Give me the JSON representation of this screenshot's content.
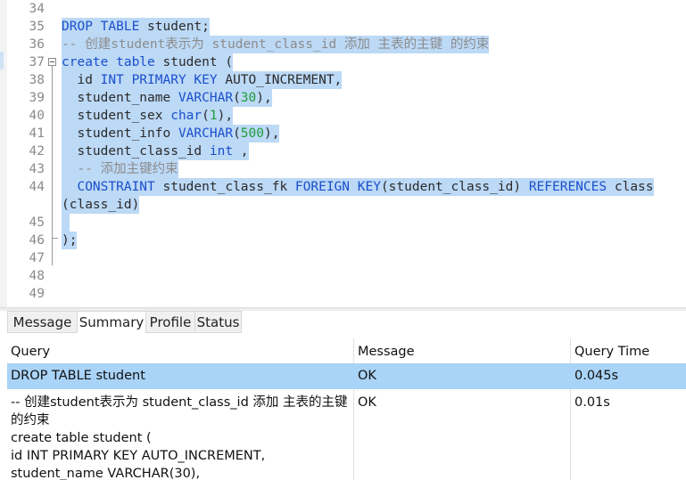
{
  "editor": {
    "lines": [
      {
        "num": "34",
        "tokens": []
      },
      {
        "num": "35",
        "tokens": [
          {
            "t": "DROP TABLE",
            "c": "kw"
          },
          {
            "t": " student;",
            "c": ""
          }
        ],
        "sel": true
      },
      {
        "num": "36",
        "tokens": [
          {
            "t": "-- 创建student表示为 student_class_id 添加 主表的主键 的约束",
            "c": "cm"
          }
        ],
        "sel": true
      },
      {
        "num": "37",
        "tokens": [
          {
            "t": "create table",
            "c": "kw"
          },
          {
            "t": " student (",
            "c": ""
          }
        ],
        "sel": true,
        "fold": true
      },
      {
        "num": "38",
        "tokens": [
          {
            "t": "  id ",
            "c": ""
          },
          {
            "t": "INT PRIMARY KEY",
            "c": "kw"
          },
          {
            "t": " AUTO_INCREMENT,",
            "c": ""
          }
        ],
        "sel": true
      },
      {
        "num": "39",
        "tokens": [
          {
            "t": "  student_name ",
            "c": ""
          },
          {
            "t": "VARCHAR",
            "c": "kw"
          },
          {
            "t": "(",
            "c": ""
          },
          {
            "t": "30",
            "c": "num"
          },
          {
            "t": "),",
            "c": ""
          }
        ],
        "sel": true
      },
      {
        "num": "40",
        "tokens": [
          {
            "t": "  student_sex ",
            "c": ""
          },
          {
            "t": "char",
            "c": "kw"
          },
          {
            "t": "(",
            "c": ""
          },
          {
            "t": "1",
            "c": "num"
          },
          {
            "t": "),",
            "c": ""
          }
        ],
        "sel": true
      },
      {
        "num": "41",
        "tokens": [
          {
            "t": "  student_info ",
            "c": ""
          },
          {
            "t": "VARCHAR",
            "c": "kw"
          },
          {
            "t": "(",
            "c": ""
          },
          {
            "t": "500",
            "c": "num"
          },
          {
            "t": "),",
            "c": ""
          }
        ],
        "sel": true
      },
      {
        "num": "42",
        "tokens": [
          {
            "t": "  student_class_id ",
            "c": ""
          },
          {
            "t": "int",
            "c": "kw"
          },
          {
            "t": " ,",
            "c": ""
          }
        ],
        "sel": true
      },
      {
        "num": "43",
        "tokens": [
          {
            "t": "  -- 添加主键约束",
            "c": "cm"
          }
        ],
        "sel": true
      },
      {
        "num": "44",
        "tokens": [
          {
            "t": "  CONSTRAINT",
            "c": "kw"
          },
          {
            "t": " student_class_fk ",
            "c": ""
          },
          {
            "t": "FOREIGN KEY",
            "c": "kw"
          },
          {
            "t": "(student_class_id) ",
            "c": ""
          },
          {
            "t": "REFERENCES",
            "c": "kw"
          },
          {
            "t": " class",
            "c": ""
          }
        ],
        "sel": true
      },
      {
        "num": "",
        "tokens": [
          {
            "t": "(class_id)",
            "c": ""
          }
        ],
        "sel": true
      },
      {
        "num": "45",
        "tokens": [
          {
            "t": " ",
            "c": ""
          }
        ],
        "sel": true
      },
      {
        "num": "46",
        "tokens": [
          {
            "t": ");",
            "c": ""
          }
        ],
        "sel": true
      },
      {
        "num": "47",
        "tokens": []
      },
      {
        "num": "48",
        "tokens": []
      },
      {
        "num": "49",
        "tokens": []
      }
    ]
  },
  "tabs": [
    {
      "label": "Message",
      "active": false
    },
    {
      "label": "Summary",
      "active": true
    },
    {
      "label": "Profile",
      "active": false
    },
    {
      "label": "Status",
      "active": false
    }
  ],
  "results": {
    "headers": {
      "query": "Query",
      "message": "Message",
      "time": "Query Time"
    },
    "rows": [
      {
        "query": "DROP TABLE student",
        "message": "OK",
        "time": "0.045s"
      },
      {
        "query": "-- 创建student表示为 student_class_id 添加 主表的主键\n的约束\ncreate table student (\nid INT PRIMARY KEY AUTO_INCREMENT,\nstudent_name VARCHAR(30),",
        "message": "OK",
        "time": "0.01s"
      }
    ]
  },
  "colors": {
    "selection": "#bcd9f6",
    "keyword": "#1a4fcc",
    "comment": "#8c8c8c",
    "number": "#1e9b3a",
    "row_highlight": "#a9d3f7"
  }
}
